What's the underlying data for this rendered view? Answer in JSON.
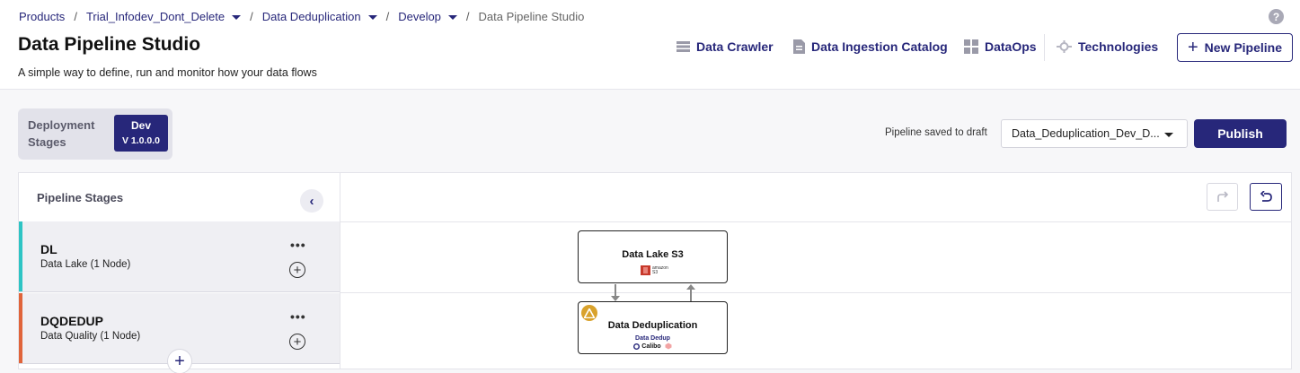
{
  "breadcrumb": {
    "items": [
      "Products",
      "Trial_Infodev_Dont_Delete",
      "Data Deduplication",
      "Develop"
    ],
    "current": "Data Pipeline Studio",
    "separator": "/"
  },
  "help_icon": "question-circle-icon",
  "header": {
    "title": "Data Pipeline Studio",
    "subtitle": "A simple way to define, run and monitor how your data flows"
  },
  "nav": {
    "data_crawler": "Data Crawler",
    "data_ingestion_catalog": "Data Ingestion Catalog",
    "dataops": "DataOps",
    "technologies": "Technologies",
    "new_pipeline": "New Pipeline"
  },
  "deployment": {
    "label": "Deployment Stages",
    "stage": "Dev",
    "version": "V 1.0.0.0"
  },
  "pipeline": {
    "saved_status": "Pipeline saved to draft",
    "selected": "Data_Deduplication_Dev_D...",
    "publish_label": "Publish"
  },
  "stages_panel": {
    "title": "Pipeline Stages",
    "stages": [
      {
        "code": "DL",
        "description": "Data Lake (1 Node)",
        "color": "#2ec4c4"
      },
      {
        "code": "DQDEDUP",
        "description": "Data Quality (1 Node)",
        "color": "#e0643a"
      }
    ]
  },
  "canvas": {
    "nodes": [
      {
        "title": "Data Lake S3",
        "logo_text": "amazon S3",
        "icon": "amazon-s3-icon"
      },
      {
        "title": "Data Deduplication",
        "subtitle": "Data Dedup",
        "logo_text": "Calibo",
        "icon": "calibo-logo-icon",
        "warning": "warning-icon"
      }
    ]
  },
  "colors": {
    "primary": "#27277a",
    "warning": "#d9a22c",
    "s3_red": "#c7392b"
  }
}
